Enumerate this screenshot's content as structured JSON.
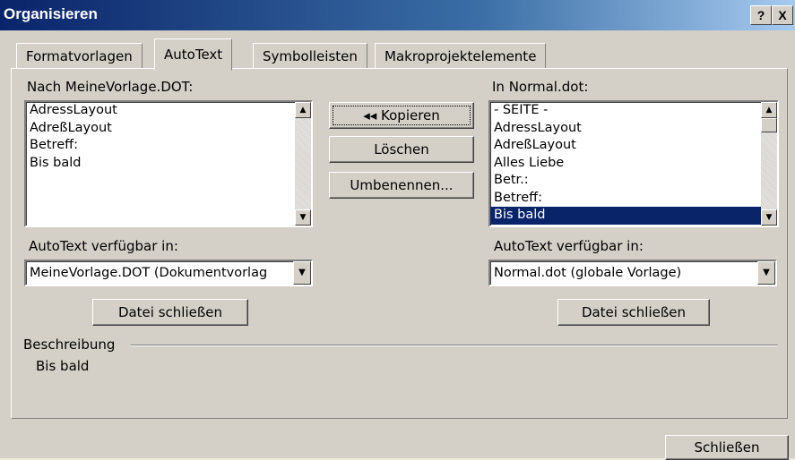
{
  "window": {
    "title": "Organisieren",
    "help_label": "?",
    "close_label": "X"
  },
  "tabs": [
    {
      "label": "Formatvorlagen"
    },
    {
      "label": "AutoText"
    },
    {
      "label": "Symbolleisten"
    },
    {
      "label": "Makroprojektelemente"
    }
  ],
  "left": {
    "list_label": "Nach MeineVorlage.DOT:",
    "items": [
      "AdressLayout",
      "AdreßLayout",
      "Betreff:",
      "Bis bald"
    ],
    "available_label": "AutoText verfügbar in:",
    "available_value": "MeineVorlage.DOT (Dokumentvorlag",
    "close_file_label": "Datei schließen"
  },
  "right": {
    "list_label": "In Normal.dot:",
    "items": [
      "- SEITE -",
      "AdressLayout",
      "AdreßLayout",
      "Alles Liebe",
      "Betr.:",
      "Betreff:",
      "Bis bald"
    ],
    "selected_item": "Bis bald",
    "available_label": "AutoText verfügbar in:",
    "available_value": "Normal.dot (globale Vorlage)",
    "close_file_label": "Datei schließen"
  },
  "actions": {
    "copy_label": "◂◂ Kopieren",
    "delete_label": "Löschen",
    "rename_label": "Umbenennen..."
  },
  "description": {
    "label": "Beschreibung",
    "text": "Bis bald"
  },
  "footer": {
    "close_label": "Schließen"
  }
}
